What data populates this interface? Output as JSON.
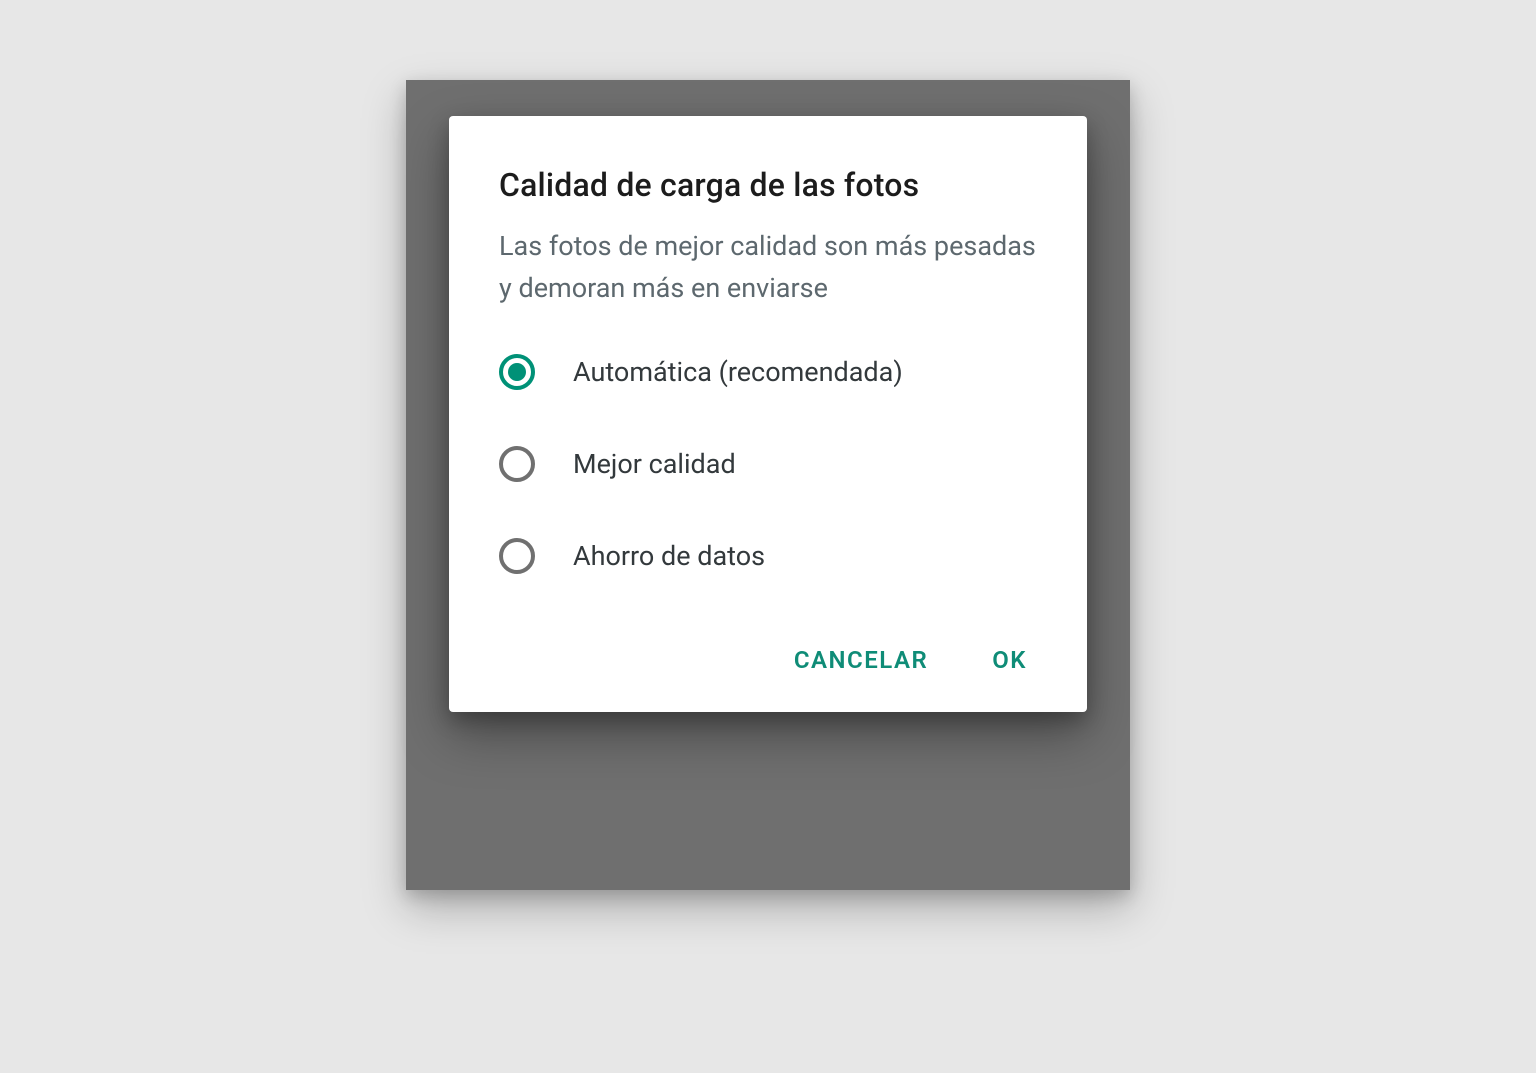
{
  "dialog": {
    "title": "Calidad de carga de las fotos",
    "subtitle": "Las fotos de mejor calidad son más pesadas y demoran más en enviarse",
    "options": [
      {
        "label": "Automática (recomendada)",
        "selected": true
      },
      {
        "label": "Mejor calidad",
        "selected": false
      },
      {
        "label": "Ahorro de datos",
        "selected": false
      }
    ],
    "buttons": {
      "cancel": "CANCELAR",
      "ok": "OK"
    }
  },
  "colors": {
    "accent": "#0f8c77",
    "radio_selected": "#009177",
    "radio_unselected": "#707070",
    "subtitle_text": "#5d686e"
  }
}
